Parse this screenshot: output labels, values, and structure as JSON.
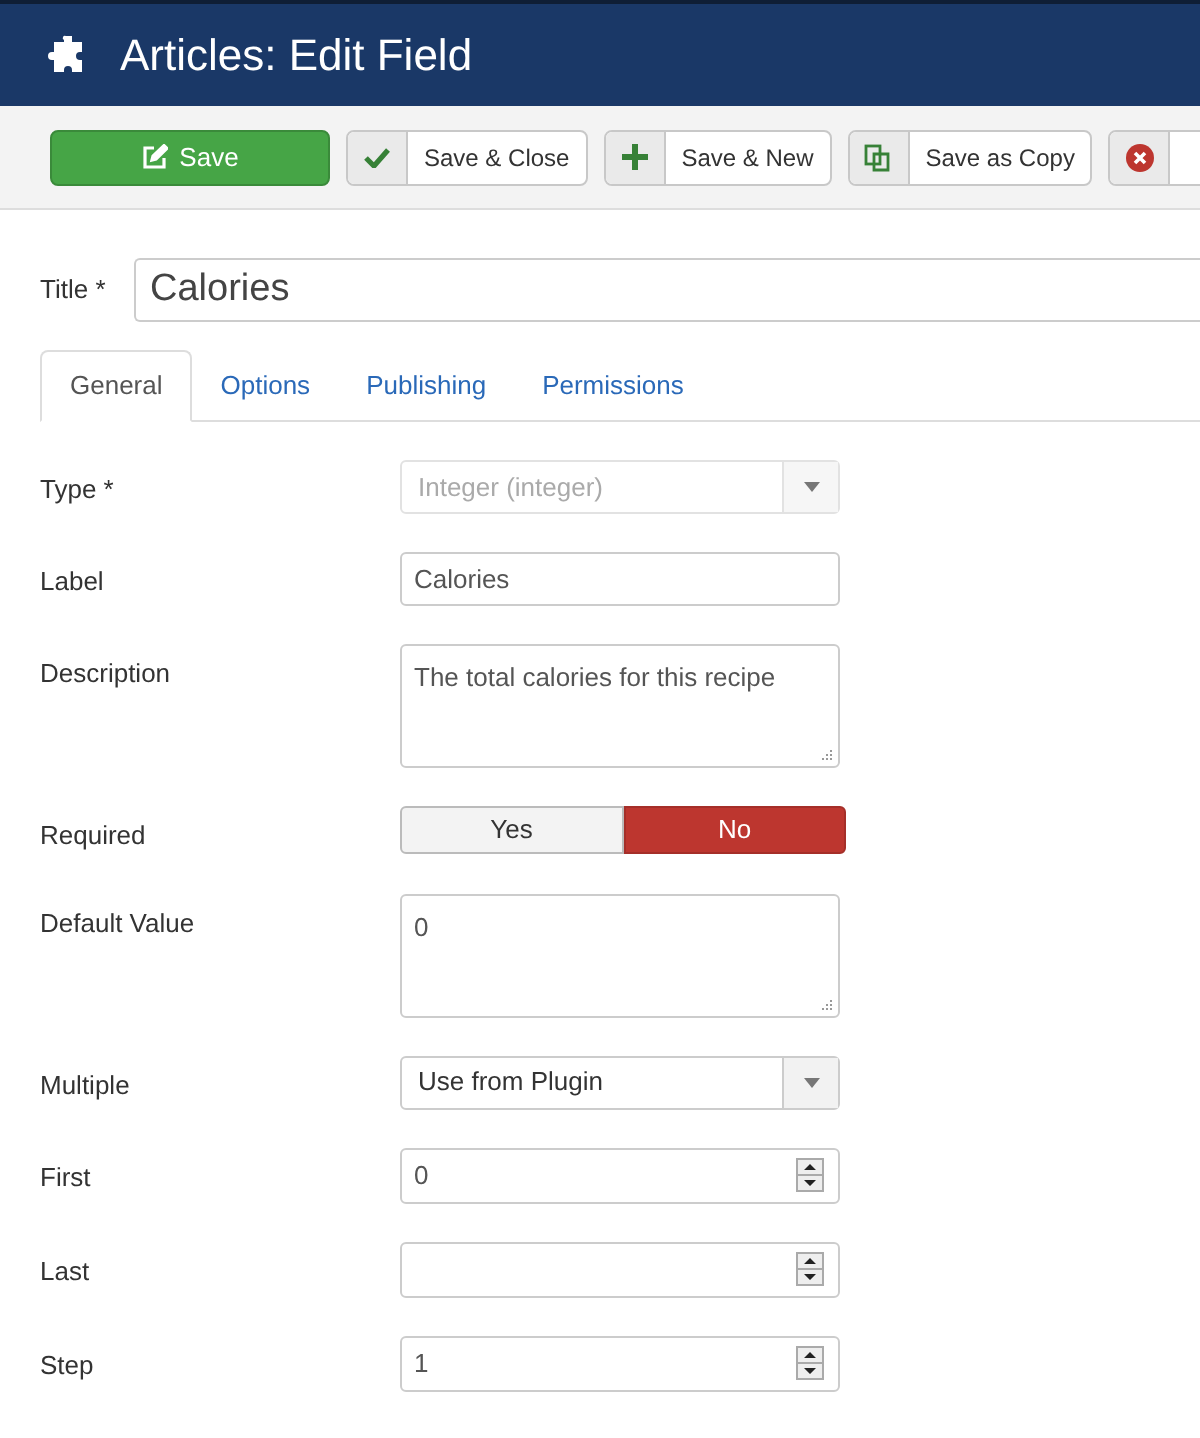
{
  "header": {
    "title": "Articles: Edit Field"
  },
  "toolbar": [
    {
      "kind": "primary",
      "label": "Save"
    },
    {
      "kind": "check",
      "label": "Save & Close"
    },
    {
      "kind": "plus",
      "label": "Save & New"
    },
    {
      "kind": "copy",
      "label": "Save as Copy"
    },
    {
      "kind": "cancel"
    }
  ],
  "title_field": {
    "label": "Title *",
    "value": "Calories"
  },
  "tabs": [
    {
      "label": "General",
      "selected": true
    },
    {
      "label": "Options",
      "selected": false
    },
    {
      "label": "Publishing",
      "selected": false
    },
    {
      "label": "Permissions",
      "selected": false
    }
  ],
  "fields": [
    {
      "kind": "select",
      "label": "Type *",
      "value": "Integer (integer)",
      "disabled": true
    },
    {
      "kind": "text",
      "label": "Label",
      "value": "Calories"
    },
    {
      "kind": "textarea",
      "label": "Description",
      "value": "The total calories for this recipe"
    },
    {
      "kind": "toggle",
      "label": "Required",
      "options": [
        {
          "label": "Yes",
          "selected": false
        },
        {
          "label": "No",
          "selected": true
        }
      ]
    },
    {
      "kind": "textarea",
      "label": "Default Value",
      "value": "0"
    },
    {
      "kind": "select",
      "label": "Multiple",
      "value": "Use from Plugin",
      "disabled": false
    },
    {
      "kind": "number",
      "label": "First",
      "value": "0"
    },
    {
      "kind": "number",
      "label": "Last"
    },
    {
      "kind": "number",
      "label": "Step",
      "value": "1"
    }
  ]
}
